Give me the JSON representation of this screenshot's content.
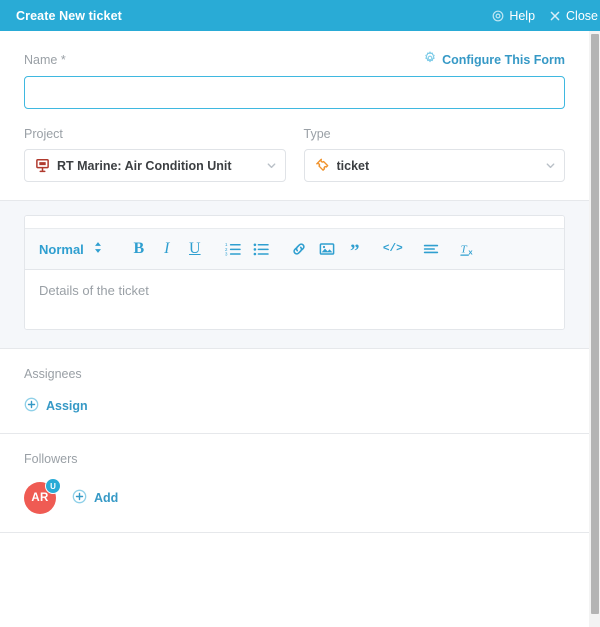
{
  "titlebar": {
    "title": "Create New ticket",
    "help_label": "Help",
    "help_icon": "lifebuoy-icon",
    "close_label": "Close",
    "close_icon": "close-icon",
    "background_color": "#29ABD6"
  },
  "name_field": {
    "label": "Name *",
    "value": "",
    "placeholder": "",
    "configure_link": "Configure This Form",
    "configure_icon": "gear-icon",
    "focused": true,
    "focus_border_color": "#3fb8e0"
  },
  "project_field": {
    "label": "Project",
    "value": "RT Marine: Air Condition Unit",
    "icon": "project-board-icon",
    "icon_color": "#b03a2e"
  },
  "type_field": {
    "label": "Type",
    "value": "ticket",
    "icon": "ticket-icon",
    "icon_color": "#f0922b"
  },
  "editor": {
    "style_label": "Normal",
    "placeholder": "Details of the ticket",
    "accent_color": "#2f9fd0",
    "toolbar": [
      {
        "name": "bold-icon",
        "glyph": "B"
      },
      {
        "name": "italic-icon",
        "glyph": "I"
      },
      {
        "name": "underline-icon",
        "glyph": "U"
      },
      {
        "name": "ordered-list-icon",
        "glyph": ""
      },
      {
        "name": "bullet-list-icon",
        "glyph": ""
      },
      {
        "name": "link-icon",
        "glyph": ""
      },
      {
        "name": "image-icon",
        "glyph": ""
      },
      {
        "name": "blockquote-icon",
        "glyph": ""
      },
      {
        "name": "code-icon",
        "glyph": ""
      },
      {
        "name": "align-icon",
        "glyph": ""
      },
      {
        "name": "clear-format-icon",
        "glyph": ""
      }
    ]
  },
  "assignees": {
    "label": "Assignees",
    "assign_label": "Assign",
    "assign_icon": "plus-circle-icon"
  },
  "followers": {
    "label": "Followers",
    "add_label": "Add",
    "add_icon": "plus-circle-icon",
    "people": [
      {
        "initials": "AR",
        "badge": "U",
        "color": "#ef5b53",
        "badge_color": "#29ABD6"
      }
    ]
  }
}
